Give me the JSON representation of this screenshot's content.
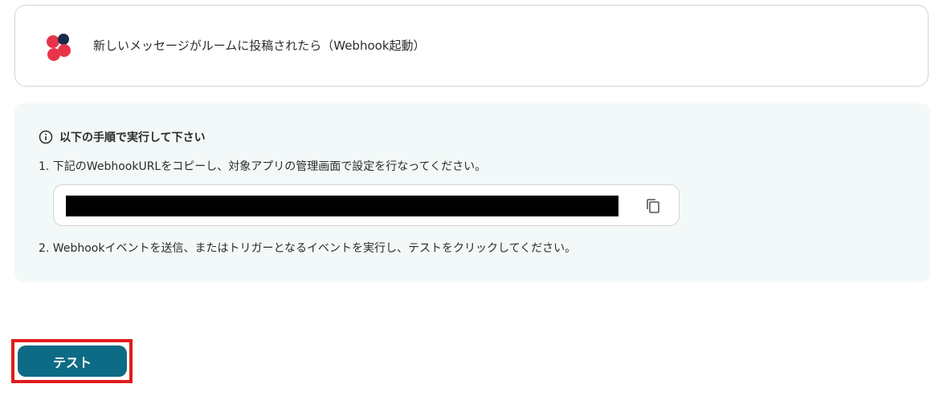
{
  "trigger": {
    "title": "新しいメッセージがルームに投稿されたら（Webhook起動）",
    "app_icon": "chatwork-logo"
  },
  "instructions": {
    "heading": "以下の手順で実行して下さい",
    "heading_icon": "info-icon",
    "step1": "1. 下記のWebhookURLをコピーし、対象アプリの管理画面で設定を行なってください。",
    "webhook_url": "",
    "copy_icon": "copy-icon",
    "step2": "2. Webhookイベントを送信、またはトリガーとなるイベントを実行し、テストをクリックしてください。"
  },
  "actions": {
    "test_label": "テスト"
  },
  "colors": {
    "accent": "#0e6b85",
    "panel_bg": "#f3f9f8",
    "highlight": "#e11b1b",
    "logo_red": "#e8344a",
    "logo_navy": "#1a2a4a"
  }
}
